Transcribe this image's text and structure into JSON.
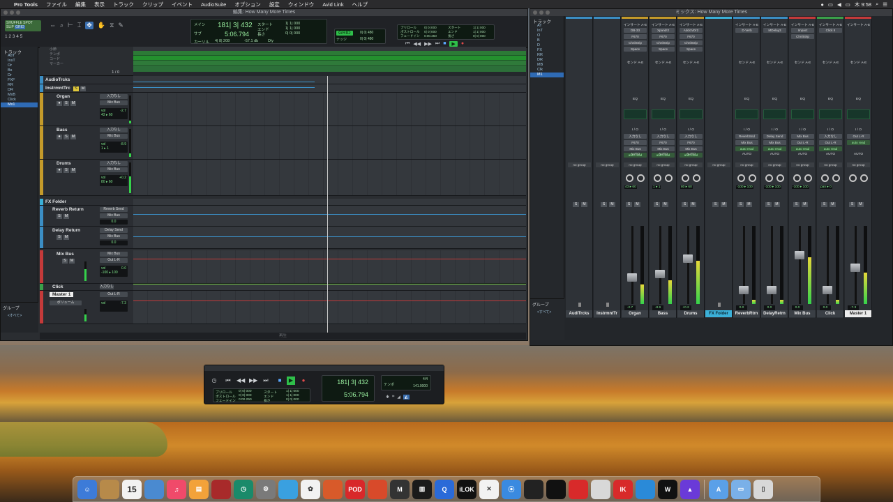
{
  "menubar": {
    "app": "Pro Tools",
    "items": [
      "ファイル",
      "編集",
      "表示",
      "トラック",
      "クリップ",
      "イベント",
      "AudioSuite",
      "オプション",
      "設定",
      "ウィンドウ",
      "Avid Link",
      "ヘルプ"
    ],
    "clock": "木 9:58"
  },
  "edit_window": {
    "title": "編集: How Many More Times",
    "mode_labels": [
      "SHUFFLE",
      "SPOT",
      "SLIP",
      "GRID"
    ],
    "numbers": "1 2 3 4 5",
    "counter": {
      "main_label": "メイン",
      "main": "181| 3| 432",
      "sub_label": "サブ",
      "sub": "5:06.794",
      "start_label": "スタート",
      "start": "1| 1| 000",
      "end_label": "エンド",
      "end": "1| 1| 000",
      "length_label": "長さ",
      "length": "0| 0| 000",
      "cursor_label": "カーソル",
      "cursor_value": "4| 8| 208",
      "extra_values": [
        "-57.1 db",
        "Dly"
      ]
    },
    "nudge_label": "ナッジ",
    "grid_value": "0| 0| 480",
    "nudge_value": "0| 0| 480",
    "preroll": {
      "pre_label": "プリロール",
      "post_label": "ポストロール",
      "fade_label": "フェードイン",
      "start_label": "スタート",
      "end_label": "エンド",
      "len_label": "長さ",
      "pre": "0| 0| 000",
      "post": "0| 0| 000",
      "fade": "0:00.250",
      "start": "1| 1| 000",
      "end": "1| 1| 000",
      "len": "0| 0| 000"
    },
    "tracklist_header": "トラック",
    "tracklist": [
      "AdT",
      "InsT",
      "Or",
      "Bs",
      "Dr",
      "FXF",
      "RR",
      "DR",
      "MxB",
      "Click",
      "Mx1"
    ],
    "ruler_labels": [
      "小節",
      "テンポ",
      "コード",
      "マーカー"
    ],
    "groups_header": "グループ",
    "groups_item": "<すべて>",
    "ruler_counter": "1 / 0",
    "status_text": "再生",
    "tracks": [
      {
        "name": "AudioTrcks",
        "type": "folder",
        "color": "#3b8ec4"
      },
      {
        "name": "InstrmntTrc",
        "type": "folder",
        "color": "#3b8ec4"
      },
      {
        "name": "Organ",
        "color": "#c49a2a",
        "insert": "入力なし",
        "bus": "Mix Bus",
        "vol_label": "vol",
        "vol": "-2.7",
        "pan": "43 ▸ 60"
      },
      {
        "name": "Bass",
        "color": "#c49a2a",
        "insert": "入力なし",
        "bus": "Mix Bus",
        "vol_label": "vol",
        "vol": "-8.9",
        "pan": "1 ▸ 1"
      },
      {
        "name": "Drums",
        "color": "#c49a2a",
        "insert": "入力なし",
        "bus": "Mix Bus",
        "vol_label": "vol",
        "vol": "+0.2",
        "pan": "80 ▸ 60"
      },
      {
        "name": "FX Folder",
        "type": "folder",
        "color": "#3bb0d8"
      },
      {
        "name": "Reverb Return",
        "color": "#3b8ec4",
        "insert": "Reverb Send",
        "bus": "Mix Bus",
        "vol": "0.0"
      },
      {
        "name": "Delay Return",
        "color": "#3b8ec4",
        "insert": "Delay Send",
        "bus": "Mix Bus",
        "vol": "0.0"
      },
      {
        "name": "Mix Bus",
        "color": "#c43a3a",
        "insert": "Mix Bus",
        "bus": "Out L-R",
        "vol_label": "vol",
        "vol": "0.0",
        "pan": "-100 ▸ 100"
      },
      {
        "name": "Click",
        "color": "#3aa04a",
        "insert": "入力なし",
        "bus": ""
      },
      {
        "name": "Master 1",
        "color": "#c43a3a",
        "insert": "Out L-R",
        "bus": "",
        "vol_label": "vol",
        "vol": "-7.3",
        "button": "ボリューム"
      }
    ],
    "lane_lines": [
      "#3b8ec4",
      "#3b8ec4",
      "#3b8ec4",
      "#3b8ec4",
      "#c43a3a",
      "#7ad04a"
    ]
  },
  "mix_window": {
    "title": "ミックス: How Many More Times",
    "tracklist_header": "トラック",
    "tracklist": [
      "AT",
      "InT",
      "O",
      "B",
      "D",
      "FX",
      "RR",
      "DR",
      "MB",
      "Clk",
      "M1"
    ],
    "groups_header": "グループ",
    "groups_item": "<すべて>",
    "section_labels": {
      "inserts": "インサート A-E",
      "sends": "センド A-E",
      "io": "I / O",
      "auto": "AUTO",
      "group": "no group",
      "eq": "EQ"
    },
    "strips": [
      {
        "name": "AudiTrcks",
        "color": "#3b8ec4",
        "folder": true,
        "inserts": [],
        "io": [],
        "vol": "",
        "pan": ""
      },
      {
        "name": "InstrmntTr",
        "color": "#3b8ec4",
        "folder": true,
        "inserts": [],
        "io": [],
        "vol": "",
        "pan": ""
      },
      {
        "name": "Organ",
        "color": "#c49a2a",
        "inserts": [
          "DB-33",
          "F670",
          "ChnlStrip",
          "Space"
        ],
        "io": [
          "入力なし",
          "F670",
          "Mix Bus",
          "auto read"
        ],
        "vol": "-2.7",
        "pan": "43 ▸ 60",
        "level": 0.25
      },
      {
        "name": "Bass",
        "color": "#c49a2a",
        "inserts": [
          "Xpand!2",
          "F670",
          "ChnlStrip",
          "Space"
        ],
        "io": [
          "入力なし",
          "F670",
          "Mix Bus",
          "auto read"
        ],
        "vol": "-8.9",
        "pan": "1 ▸ 1",
        "level": 0.3
      },
      {
        "name": "Drums",
        "color": "#c49a2a",
        "inserts": [
          "AddctvDr2",
          "F670",
          "ChnlStrip",
          "Space"
        ],
        "io": [
          "入力なし",
          "F670",
          "Mix Bus",
          "auto read"
        ],
        "vol": "+0.2",
        "pan": "80 ▸ 60",
        "level": 0.55
      },
      {
        "name": "FX Folder",
        "color": "#3bb0d8",
        "folder": true,
        "inserts": [],
        "io": [],
        "vol": "",
        "pan": ""
      },
      {
        "name": "ReverbRtrn",
        "color": "#3b8ec4",
        "inserts": [
          "D-Verb"
        ],
        "io": [
          "ReverbSnd",
          "Mix Bus",
          "auto read"
        ],
        "vol": "0.0",
        "pan": "-100 ▸ 100",
        "level": 0.05
      },
      {
        "name": "DelayRetrn",
        "color": "#3b8ec4",
        "inserts": [
          "MDelay3"
        ],
        "io": [
          "Delay Send",
          "Mix Bus",
          "auto read"
        ],
        "vol": "0.0",
        "pan": "-100 ▸ 100",
        "level": 0.05
      },
      {
        "name": "Mix Bus",
        "color": "#c43a3a",
        "inserts": [
          "Impact",
          "ChnlStrip"
        ],
        "io": [
          "Mix Bus",
          "Out L-R",
          "auto read"
        ],
        "vol": "0.0",
        "pan": "-100 ▸ 100",
        "level": 0.6
      },
      {
        "name": "Click",
        "color": "#3aa04a",
        "inserts": [
          "Click II"
        ],
        "io": [
          "入力なし",
          "Out L-R",
          "auto read"
        ],
        "vol": "0.0",
        "pan": "pan ▸ 0",
        "level": 0.05
      },
      {
        "name": "Master 1",
        "color": "#c43a3a",
        "inserts": [],
        "io": [
          "Out L-R",
          "auto read"
        ],
        "vol": "-7.3",
        "pan": "",
        "level": 0.4
      }
    ]
  },
  "transport": {
    "main": "181| 3| 432",
    "sub": "5:06.794",
    "tempo_label": "テンポ",
    "tempo": "141.0000",
    "meter": "4/4",
    "preroll_labels": [
      "プリロール",
      "ポストロール",
      "フェードイン"
    ],
    "preroll_values": [
      "0| 0| 000",
      "0| 0| 000",
      "0:00.250"
    ],
    "range_labels": [
      "スタート",
      "エンド",
      "長さ"
    ],
    "range_values": [
      "1| 1| 000",
      "1| 1| 000",
      "0| 0| 000"
    ]
  },
  "dock": {
    "icons": [
      "finder-icon",
      "notes-icon",
      "calendar-icon",
      "preview-icon",
      "music-icon",
      "books-icon",
      "photo-booth-icon",
      "time-machine-icon",
      "system-preferences-icon",
      "maps-icon",
      "photos-icon",
      "instruments-icon",
      "pod-farm-icon",
      "mascot-icon",
      "mbox-icon",
      "keyboard-icon",
      "quicktime-icon",
      "ilok-icon",
      "x-icon",
      "safari-icon",
      "blackmagic-icon",
      "wavelab-icon",
      "native-instruments-icon",
      "sonarworks-icon",
      "ik-icon",
      "avid-link-icon",
      "waves-icon",
      "pro-tools-icon",
      "applications-folder-icon",
      "documents-folder-icon",
      "trash-icon"
    ],
    "calendar_day": "15"
  }
}
